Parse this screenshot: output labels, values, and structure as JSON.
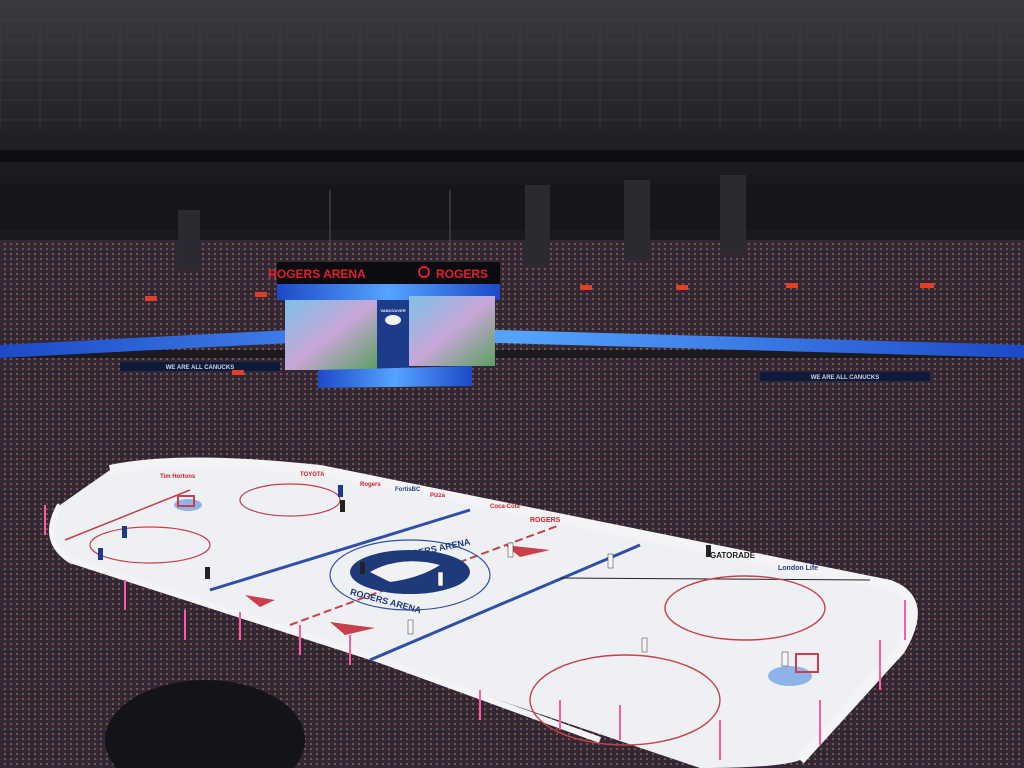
{
  "scene": {
    "venue_sign_left": "ROGERS ARENA",
    "venue_sign_right": "ROGERS",
    "scoreboard_logo": "VANCOUVER",
    "center_ice_text_top": "ROGERS ARENA",
    "center_ice_text_bottom": "ROGERS ARENA",
    "rail_banner_left": "WE ARE ALL CANUCKS",
    "rail_banner_right": "WE ARE ALL CANUCKS",
    "dasher_ads": [
      "Tim Hortons",
      "TOYOTA",
      "Rogers",
      "FortisBC",
      "Pizza",
      "Coca-Cola",
      "ROGERS",
      "GATORADE",
      "London Life"
    ]
  },
  "colors": {
    "ceiling": "#2b2b2f",
    "seats": "#4a2a30",
    "ice": "#eef0f4",
    "blue_line": "#2f4fa8",
    "red_line": "#c8404a",
    "led_ribbon": "#2f7dff",
    "rogers_red": "#e0202a"
  }
}
